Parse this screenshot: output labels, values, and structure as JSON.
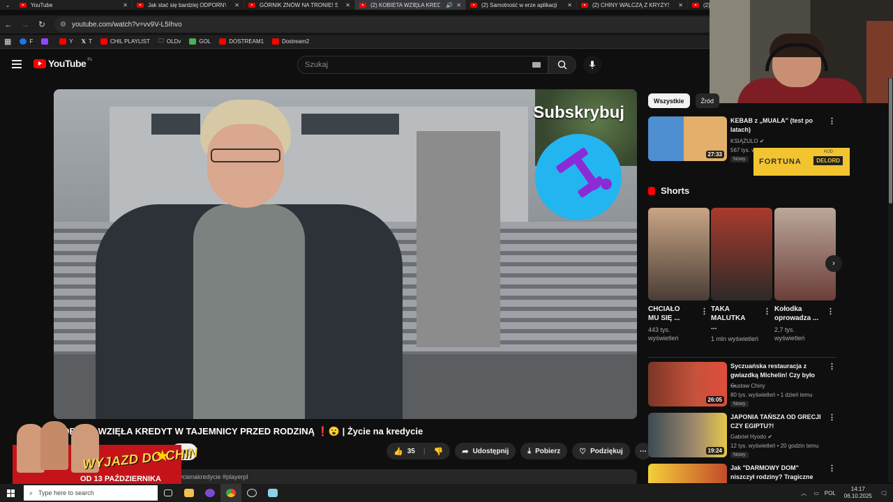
{
  "browser": {
    "tabs": [
      {
        "label": "YouTube",
        "active": false
      },
      {
        "label": "Jak stać się bardziej ODPORNYM",
        "active": false
      },
      {
        "label": "GÓRNIK ZNÓW NA TRONIE! Sz",
        "active": false
      },
      {
        "label": "(2) KOBIETA WZIĘŁA KREDY",
        "active": true
      },
      {
        "label": "(2) Samotność w erze aplikacji",
        "active": false
      },
      {
        "label": "(2) CHINY WALCZĄ Z KRYZYSEM",
        "active": false
      },
      {
        "label": "(2) M",
        "active": false
      }
    ],
    "url": "youtube.com/watch?v=vv9V-L5Ihvo",
    "bookmarks": [
      {
        "label": "F",
        "color": "#1877f2"
      },
      {
        "label": "",
        "color": "#9146ff"
      },
      {
        "label": "Y",
        "color": "#ff0000"
      },
      {
        "label": "T",
        "color": "#ffffff"
      },
      {
        "label": "CHIL PLAYLIST",
        "color": "#ff0000"
      },
      {
        "label": "OLDv",
        "color": "#bbbbbb"
      },
      {
        "label": "GOL",
        "color": "#4caf50"
      },
      {
        "label": "DOSTREAM1",
        "color": "#ff0000"
      },
      {
        "label": "Dostream2",
        "color": "#ff0000"
      }
    ]
  },
  "youtube": {
    "logo": "YouTube",
    "region": "PL",
    "search_placeholder": "Szukaj"
  },
  "video": {
    "overlay_subscribe": "Subskrybuj",
    "title": "KOBIETA WZIĘŁA KREDYT W TAJEMNICY PRZED RODZINĄ ❗😮 | Życie na kredycie",
    "subscribe_label": "buj",
    "likes": "35",
    "share_label": "Udostępnij",
    "download_label": "Pobierz",
    "thanks_label": "Podziękuj",
    "description_tags": "ycienakredycie #playerpl"
  },
  "promo": {
    "headline": "WYJAZD DO CHIN",
    "date": "OD 13 PAŹDZIERNIKA"
  },
  "sidebar": {
    "chips": [
      "Wszystkie",
      "Źród"
    ],
    "top_rec": {
      "title": "KEBAB z „MUALA” (test po latach)",
      "channel": "KSIĄŻULO",
      "meta": "567 tys. wyświetleń • 19 godzin temu",
      "badge": "Nowy",
      "duration": "27:33"
    },
    "ad": {
      "brand": "FORTUNA",
      "kod": "KOD",
      "code": "DELORD"
    },
    "shorts_heading": "Shorts",
    "shorts": [
      {
        "title": "CHCIAŁO MU SIĘ ...",
        "views": "443 tys. wyświetleń"
      },
      {
        "title": "TAKA MALUTKA ...",
        "views": "1 mln wyświetleń"
      },
      {
        "title": "Kołodka oprowadza ...",
        "views": "2,7 tys. wyświetleń"
      }
    ],
    "recs": [
      {
        "title": "Syczuańska restauracja z gwiazdką Michelin! Czy było ...",
        "channel": "Gustaw Chiny",
        "meta": "80 tys. wyświetleń • 1 dzień temu",
        "badge": "Nowy",
        "duration": "26:05"
      },
      {
        "title": "JAPONIA TAŃSZA OD GRECJI CZY EGIPTU?!",
        "channel": "Gabriel Hyodo",
        "meta": "12 tys. wyświetleń • 20 godzin temu",
        "badge": "Nowy",
        "duration": "19:24"
      },
      {
        "title": "Jak \"DARMOWY DOM\" niszczył rodziny? Tragiczne losy ...",
        "channel": "",
        "meta": "",
        "badge": "",
        "duration": ""
      }
    ]
  },
  "taskbar": {
    "search_placeholder": "Type here to search",
    "lang": "POL",
    "time": "14:17",
    "date": "06.10.2025"
  },
  "colors": {
    "accent": "#ff0000",
    "bg": "#0f0f0f",
    "chip": "#272727"
  }
}
